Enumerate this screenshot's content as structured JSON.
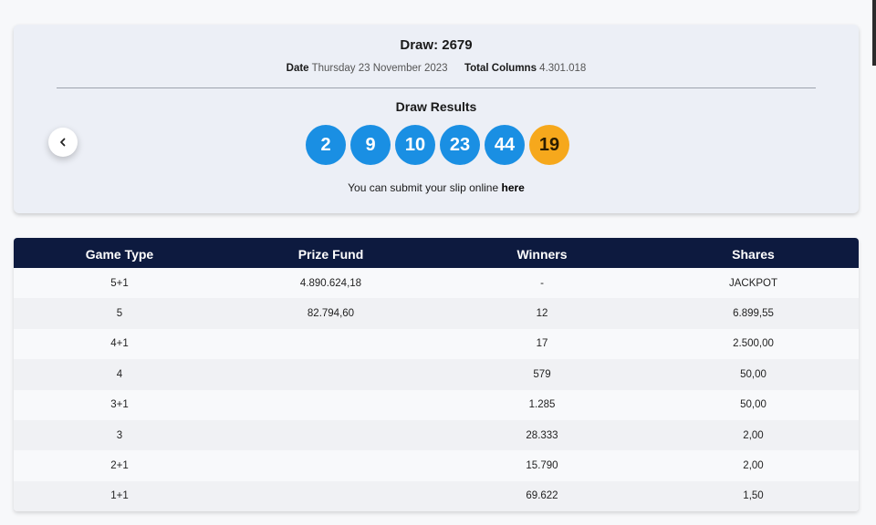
{
  "draw": {
    "title": "Draw: 2679",
    "date_label": "Date",
    "date_value": "Thursday 23 November 2023",
    "columns_label": "Total Columns",
    "columns_value": "4.301.018"
  },
  "results": {
    "title": "Draw Results",
    "numbers": [
      "2",
      "9",
      "10",
      "23",
      "44"
    ],
    "bonus": "19",
    "colors": {
      "main_ball": "#1a8fe3",
      "bonus_ball": "#f6a81c"
    },
    "slip_text": "You can submit your slip online",
    "slip_link": "here"
  },
  "nav": {
    "prev_icon": "chevron-left-icon"
  },
  "table": {
    "headers": [
      "Game Type",
      "Prize Fund",
      "Winners",
      "Shares"
    ],
    "rows": [
      [
        "5+1",
        "4.890.624,18",
        "-",
        "JACKPOT"
      ],
      [
        "5",
        "82.794,60",
        "12",
        "6.899,55"
      ],
      [
        "4+1",
        "",
        "17",
        "2.500,00"
      ],
      [
        "4",
        "",
        "579",
        "50,00"
      ],
      [
        "3+1",
        "",
        "1.285",
        "50,00"
      ],
      [
        "3",
        "",
        "28.333",
        "2,00"
      ],
      [
        "2+1",
        "",
        "15.790",
        "2,00"
      ],
      [
        "1+1",
        "",
        "69.622",
        "1,50"
      ]
    ]
  }
}
